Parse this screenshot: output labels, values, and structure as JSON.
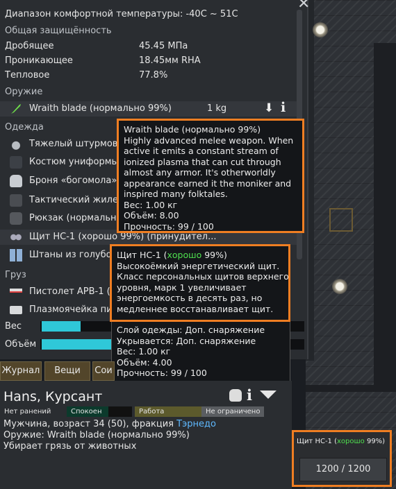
{
  "stats": {
    "comfort_range": "Диапазон комфортной температуры: -40C ~ 51C",
    "protection_header": "Общая защищённость",
    "rows": [
      {
        "label": "Дробящее",
        "value": "45.45 МПа"
      },
      {
        "label": "Проникающее",
        "value": "18.45мм RHA"
      },
      {
        "label": "Тепловое",
        "value": "77.8%"
      }
    ]
  },
  "weapons": {
    "header": "Оружие",
    "item": {
      "label": "Wraith blade (нормально 99%)",
      "weight": "1 kg"
    }
  },
  "apparel": {
    "header": "Одежда",
    "items": [
      {
        "label": "Тяжелый штурмово"
      },
      {
        "label": "Костюм униформы С"
      },
      {
        "label": "Броня «богомола» ("
      },
      {
        "label": "Тактический жилет ("
      },
      {
        "label": "Рюкзак (нормально "
      },
      {
        "label": "Щит НС-1 (хорошо 99%) (принудител..."
      },
      {
        "label": "Штаны из голубого"
      }
    ]
  },
  "cargo": {
    "header": "Груз",
    "items": [
      {
        "label": "Пистолет АРВ-1 ("
      },
      {
        "label": "Плазмоячейка писі"
      }
    ]
  },
  "bars": {
    "weight_label": "Вес",
    "volume_label": "Объём",
    "weight_fill": 0.15,
    "volume_fill": 0.29
  },
  "tooltip_blade": {
    "lines": [
      "Wraith blade (нормально 99%)",
      "Highly advanced melee weapon. When",
      "active it emits a constant stream of",
      "ionized plasma that can cut through",
      "almost any armor. It's otherworldly",
      "appearance earned it the moniker and",
      "inspired many folktales.",
      "Вес: 1.00 кг",
      "Объём: 8.00",
      "Прочность: 99 / 100"
    ]
  },
  "tooltip_shield": {
    "title_pre": "Щит НС-1 (",
    "title_quality": "хорошо",
    "title_post": " 99%)",
    "lines": [
      "Высокоёмкий энергетический щит.",
      "Класс персональных щитов верхнего",
      "уровня, марк 1 увеличивает",
      "энергоемкость в десять раз, но",
      "медленнее восстанавливает щит."
    ],
    "details": [
      "Слой одежды: Доп. снаряжение",
      "Укрывается: Доп. снаряжение",
      "Вес: 1.00 кг",
      "Объём: 4.00",
      "Прочность: 99 / 100"
    ]
  },
  "tabs": [
    "Журнал",
    "Вещи",
    "Сои"
  ],
  "pawn": {
    "name": "Hans, Курсант",
    "chips": [
      "Нет ранений",
      "Спокоен",
      "Работа",
      "Не ограничено"
    ],
    "desc_pre": "Мужчина, возраст 34 (50), фракция ",
    "faction": "Тэрнедо",
    "weapon": "Оружие: Wraith blade (нормально 99%)",
    "job": "Убирает грязь от животных"
  },
  "shield_gizmo": {
    "title_pre": "Щит НС-1 (",
    "title_quality": "хорошо",
    "title_post": " 99%)",
    "value": "1200 / 1200"
  },
  "colors": {
    "accent": "#ef7e22",
    "bar": "#2fc8d8",
    "quality": "#4fe04f",
    "link": "#5fb9ff"
  }
}
